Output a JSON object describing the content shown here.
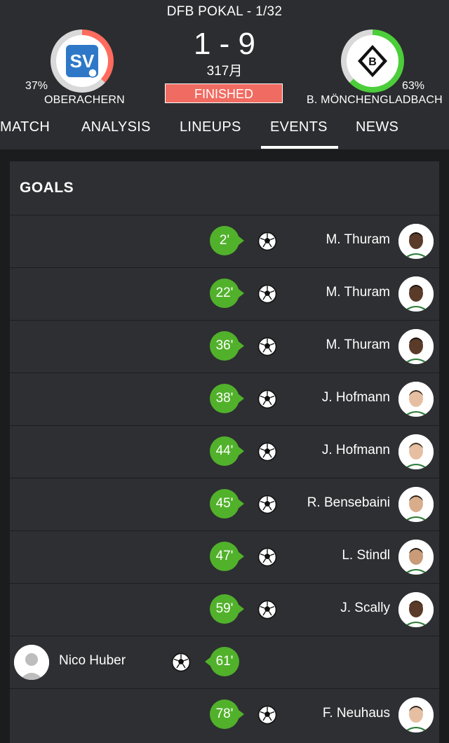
{
  "header": {
    "competition": "DFB POKAL - 1/32",
    "score": "1 - 9",
    "date": "317月",
    "status": "FINISHED",
    "home": {
      "name": "OBERACHERN",
      "percent": "37%",
      "accent": "#ff6b5e"
    },
    "away": {
      "name": "B. MÖNCHENGLADBACH",
      "percent": "63%",
      "accent": "#4ccd3a"
    }
  },
  "tabs": [
    "MATCH",
    "ANALYSIS",
    "LINEUPS",
    "EVENTS",
    "NEWS"
  ],
  "active_tab": "EVENTS",
  "section_title": "GOALS",
  "goals": [
    {
      "minute": "2'",
      "player": "M. Thuram",
      "team": "away"
    },
    {
      "minute": "22'",
      "player": "M. Thuram",
      "team": "away"
    },
    {
      "minute": "36'",
      "player": "M. Thuram",
      "team": "away"
    },
    {
      "minute": "38'",
      "player": "J. Hofmann",
      "team": "away"
    },
    {
      "minute": "44'",
      "player": "J. Hofmann",
      "team": "away"
    },
    {
      "minute": "45'",
      "player": "R. Bensebaini",
      "team": "away"
    },
    {
      "minute": "47'",
      "player": "L. Stindl",
      "team": "away"
    },
    {
      "minute": "59'",
      "player": "J. Scally",
      "team": "away"
    },
    {
      "minute": "61'",
      "player": "Nico Huber",
      "team": "home"
    },
    {
      "minute": "78'",
      "player": "F. Neuhaus",
      "team": "away"
    }
  ]
}
